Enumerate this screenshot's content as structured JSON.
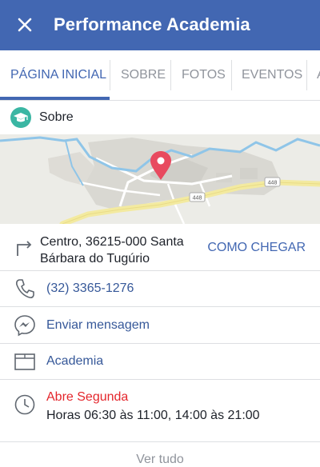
{
  "header": {
    "title": "Performance Academia"
  },
  "tabs": [
    {
      "label": "PÁGINA INICIAL",
      "active": true
    },
    {
      "label": "SOBRE"
    },
    {
      "label": "FOTOS"
    },
    {
      "label": "EVENTOS"
    },
    {
      "label": "A"
    }
  ],
  "about": {
    "label": "Sobre"
  },
  "map": {
    "road_labels": [
      "448",
      "448"
    ]
  },
  "address": {
    "line1": "Centro, 36215-000 Santa",
    "line2": "Bárbara do Tugúrio",
    "directions_label": "COMO CHEGAR"
  },
  "phone": {
    "value": "(32) 3365-1276"
  },
  "message": {
    "label": "Enviar mensagem"
  },
  "category": {
    "label": "Academia"
  },
  "hours": {
    "status": "Abre Segunda",
    "text": "Horas 06:30 às 11:00, 14:00 às 21:00"
  },
  "footer": {
    "see_all": "Ver tudo"
  },
  "colors": {
    "brand": "#4267b2",
    "link": "#365899",
    "closed": "#e4262c",
    "map_pin": "#e84a5f",
    "about_icon": "#3ab6a3"
  },
  "icons": [
    "close-icon",
    "graduation-cap-icon",
    "map-pin-icon",
    "directions-icon",
    "phone-icon",
    "messenger-icon",
    "category-icon",
    "clock-icon"
  ]
}
